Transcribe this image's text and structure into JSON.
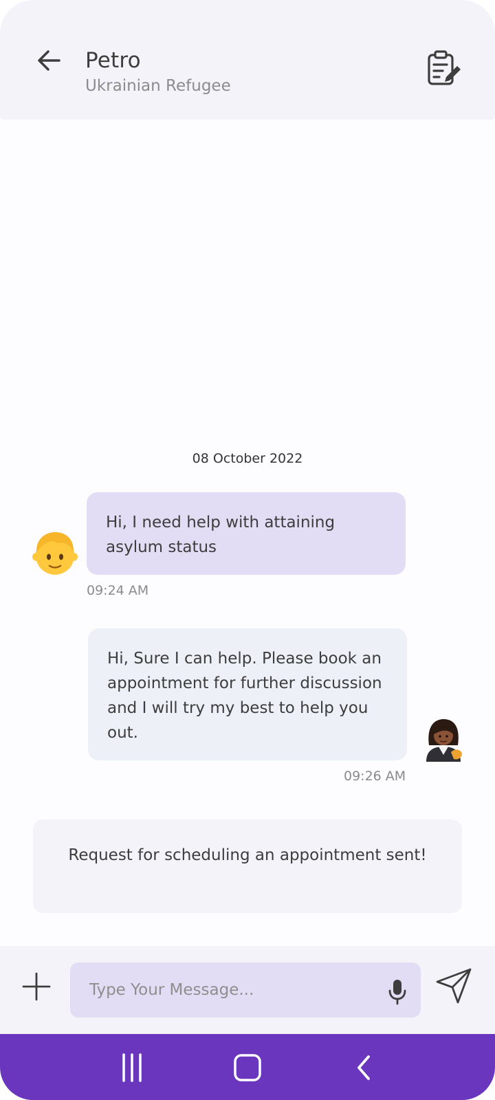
{
  "header": {
    "title": "Petro",
    "subtitle": "Ukrainian Refugee",
    "back_icon": "arrow-left-icon",
    "notes_icon": "clipboard-edit-icon"
  },
  "chat": {
    "date": "08 October 2022",
    "messages": [
      {
        "direction": "incoming",
        "text": "Hi, I need help with attaining asylum status",
        "time": "09:24 AM",
        "avatar_icon": "boy-emoji-avatar"
      },
      {
        "direction": "outgoing",
        "text": "Hi, Sure I can help. Please book an appointment for further discussion and I will try my best to help you out.",
        "time": "09:26 AM",
        "avatar_icon": "woman-professional-emoji-avatar"
      }
    ],
    "notice": "Request for scheduling an appointment sent!"
  },
  "composer": {
    "placeholder": "Type Your Message...",
    "value": "",
    "attach_icon": "plus-icon",
    "mic_icon": "microphone-icon",
    "send_icon": "paper-plane-send-icon"
  },
  "system_nav": {
    "recents_icon": "recents-icon",
    "home_icon": "home-icon",
    "back_icon": "chevron-left-icon"
  },
  "colors": {
    "accent": "#6a36bd",
    "incoming_bubble": "#e2ddf4",
    "outgoing_bubble": "#eef0f7",
    "header_bg": "#f4f3fa"
  }
}
